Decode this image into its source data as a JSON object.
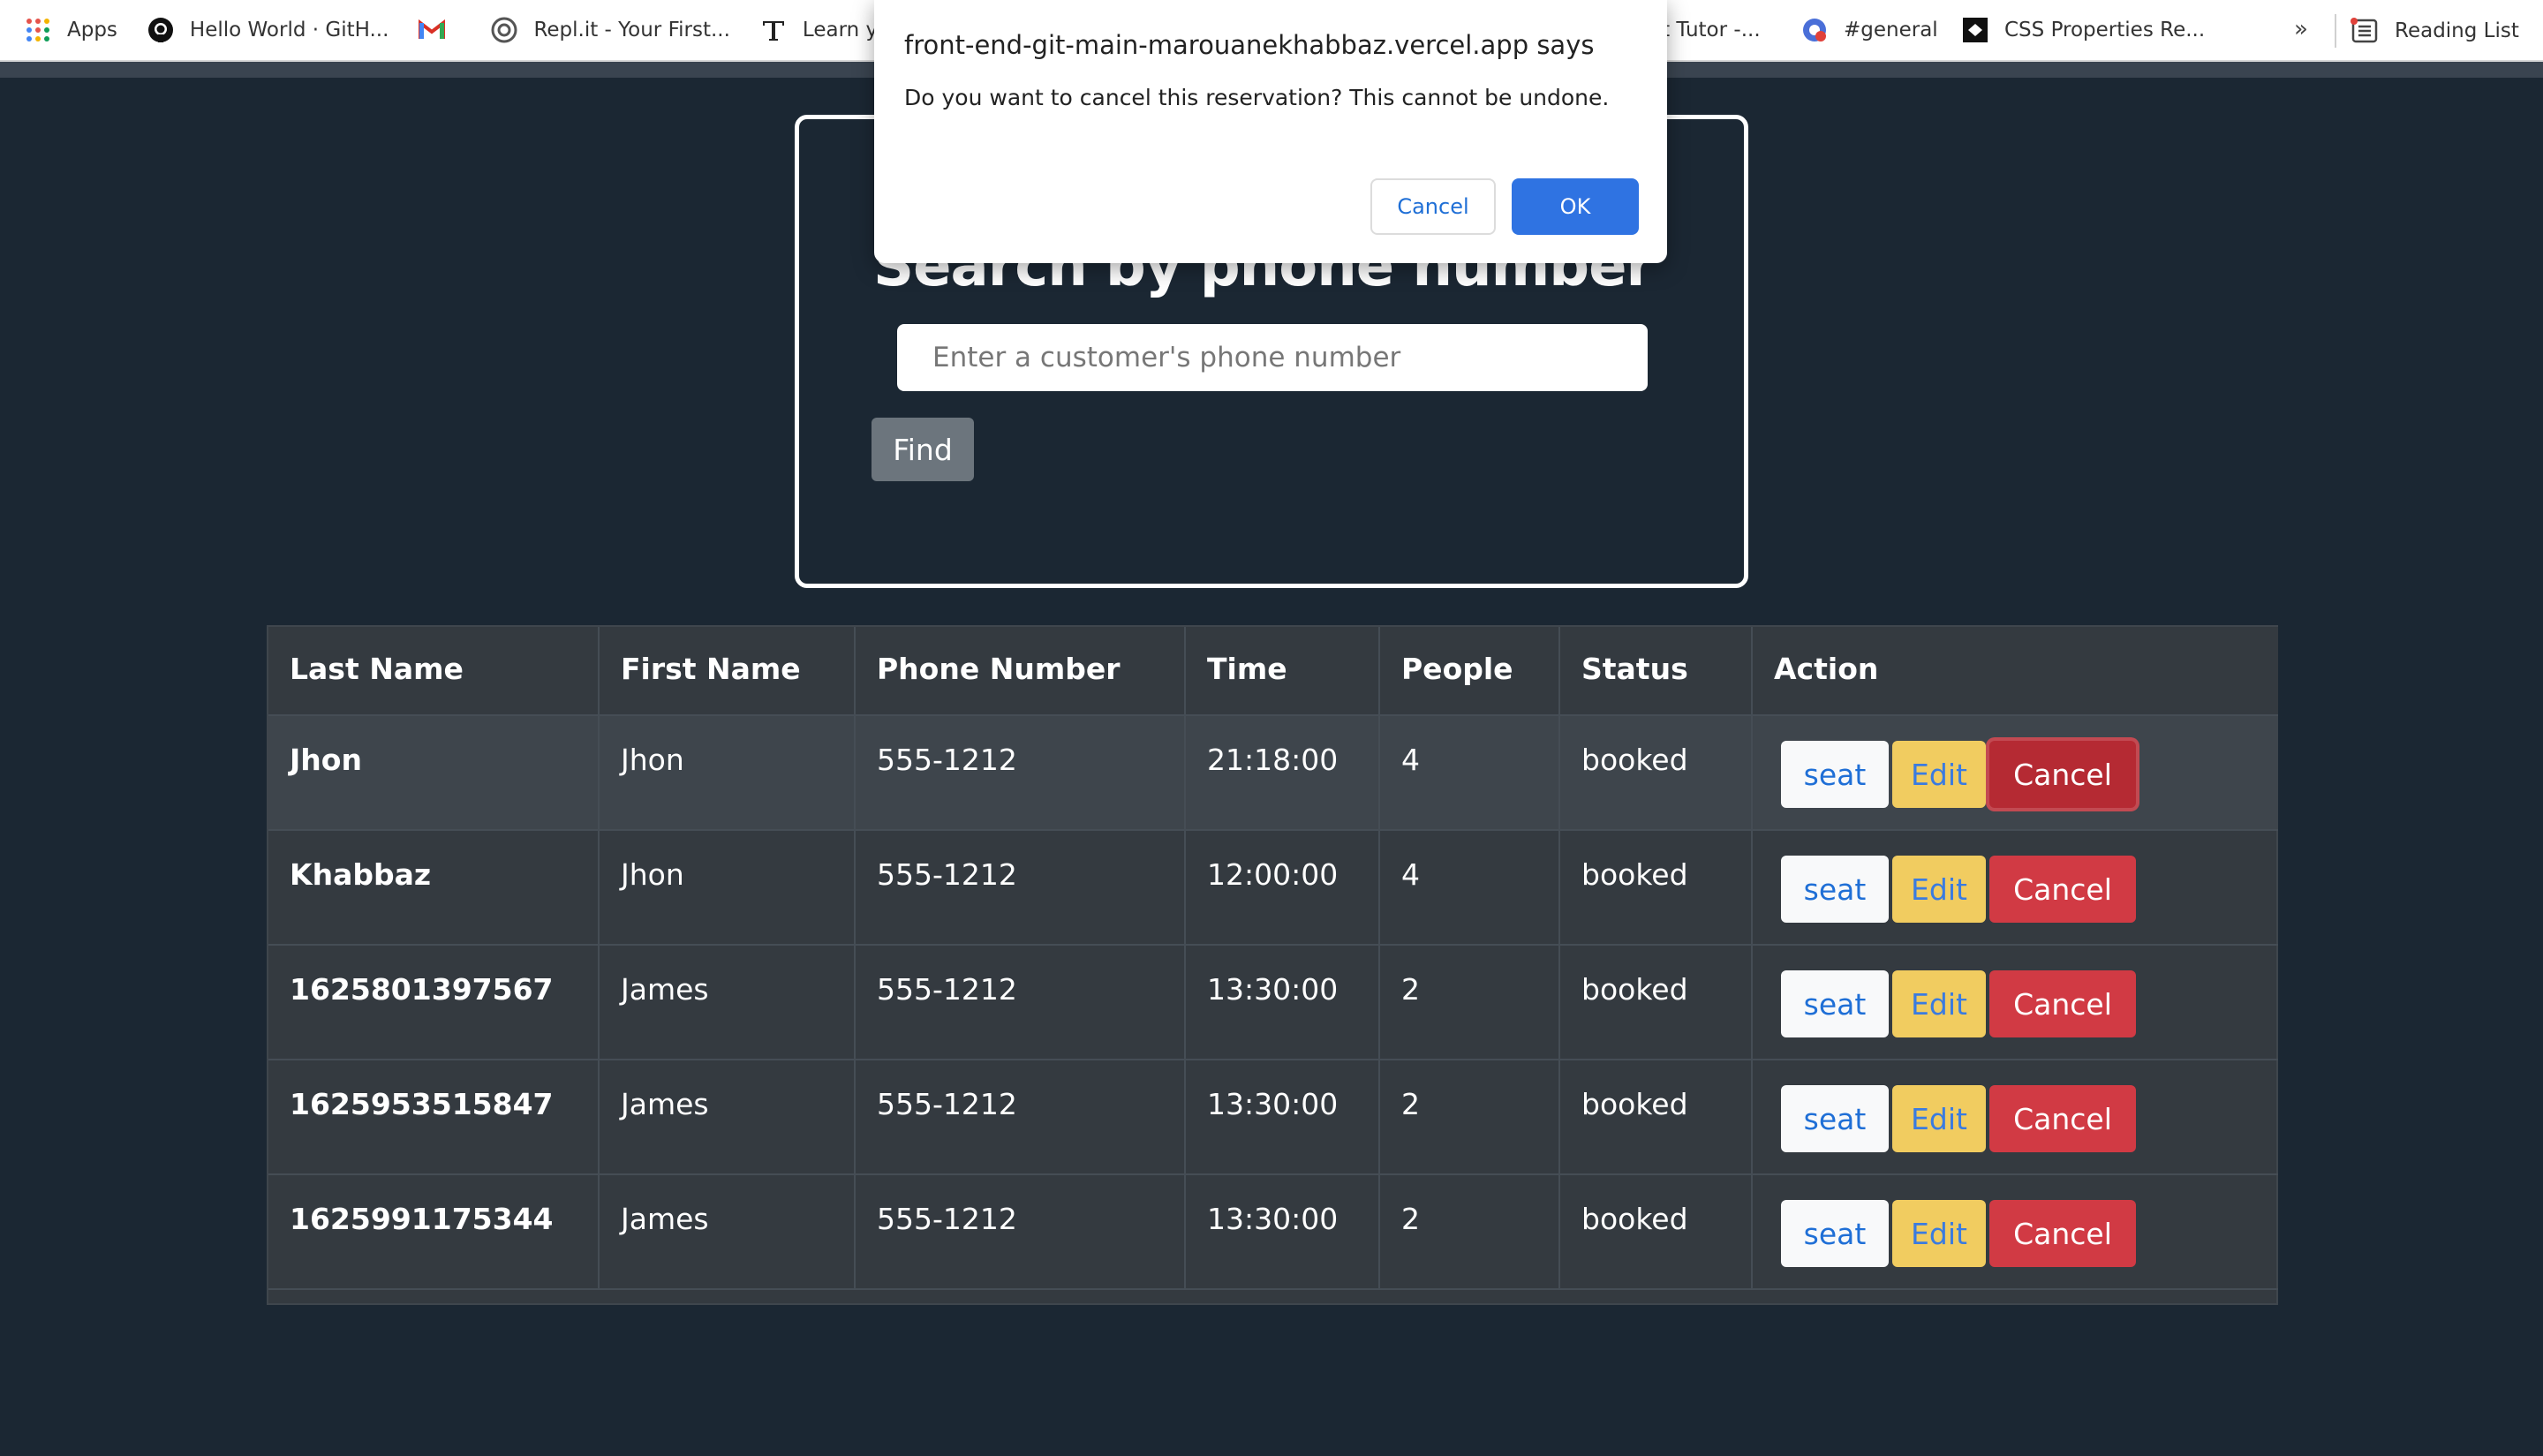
{
  "bookmarks": {
    "items": [
      {
        "label": "Apps",
        "icon": "apps-grid-icon"
      },
      {
        "label": "Hello World · GitH...",
        "icon": "github-icon"
      },
      {
        "label": "",
        "icon": "gmail-icon"
      },
      {
        "label": "Repl.it - Your First...",
        "icon": "replit-icon"
      },
      {
        "label": "Learn you",
        "icon": "typography-icon"
      }
    ],
    "partial_label": "ot Tutor -...",
    "general_label": "#general",
    "css_label": "CSS Properties Re...",
    "more": "»",
    "reading_list": "Reading List"
  },
  "search": {
    "title": "Search by phone number",
    "placeholder": "Enter a customer's phone number",
    "find_label": "Find"
  },
  "table": {
    "headers": [
      "Last Name",
      "First Name",
      "Phone Number",
      "Time",
      "People",
      "Status",
      "Action"
    ],
    "rows": [
      {
        "last": "Jhon",
        "first": "Jhon",
        "phone": "555-1212",
        "time": "21:18:00",
        "people": "4",
        "status": "booked"
      },
      {
        "last": "Khabbaz",
        "first": "Jhon",
        "phone": "555-1212",
        "time": "12:00:00",
        "people": "4",
        "status": "booked"
      },
      {
        "last": "1625801397567",
        "first": "James",
        "phone": "555-1212",
        "time": "13:30:00",
        "people": "2",
        "status": "booked"
      },
      {
        "last": "1625953515847",
        "first": "James",
        "phone": "555-1212",
        "time": "13:30:00",
        "people": "2",
        "status": "booked"
      },
      {
        "last": "1625991175344",
        "first": "James",
        "phone": "555-1212",
        "time": "13:30:00",
        "people": "2",
        "status": "booked"
      }
    ],
    "actions": {
      "seat": "seat",
      "edit": "Edit",
      "cancel": "Cancel"
    }
  },
  "dialog": {
    "origin": "front-end-git-main-marouanekhabbaz.vercel.app says",
    "message": "Do you want to cancel this reservation? This cannot be undone.",
    "cancel_label": "Cancel",
    "ok_label": "OK"
  },
  "colors": {
    "background": "#1b2733",
    "table_bg": "#343a40",
    "seat": "#f8f9fa",
    "edit": "#f1cc60",
    "cancel": "#d13a44",
    "ok": "#2f73e2"
  }
}
